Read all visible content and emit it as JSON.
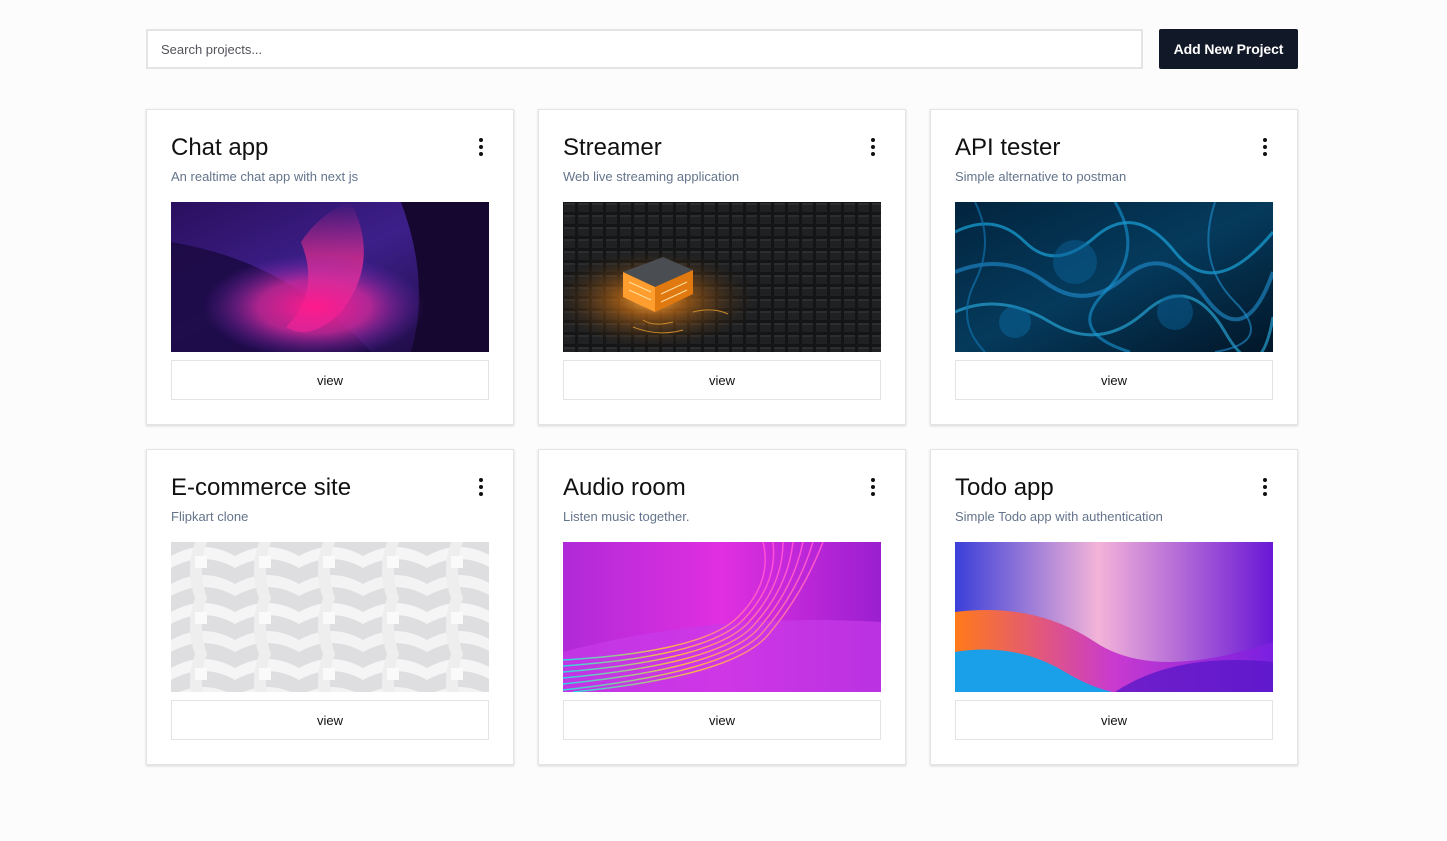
{
  "search": {
    "placeholder": "Search projects..."
  },
  "toolbar": {
    "add_label": "Add New Project"
  },
  "projects": [
    {
      "title": "Chat app",
      "description": "An realtime chat app with next js",
      "view_label": "view",
      "image": "purple-pink-gradient-image"
    },
    {
      "title": "Streamer",
      "description": "Web live streaming application",
      "view_label": "view",
      "image": "glowing-chip-image"
    },
    {
      "title": "API tester",
      "description": "Simple alternative to postman",
      "view_label": "view",
      "image": "blue-fluid-image"
    },
    {
      "title": "E-commerce site",
      "description": "Flipkart clone",
      "view_label": "view",
      "image": "white-weave-pattern-image"
    },
    {
      "title": "Audio room",
      "description": "Listen music together.",
      "view_label": "view",
      "image": "magenta-lines-image"
    },
    {
      "title": "Todo app",
      "description": "Simple Todo app with authentication",
      "view_label": "view",
      "image": "violet-orange-wave-image"
    }
  ],
  "colors": {
    "accent": "#111827",
    "background": "#fcfcfc",
    "description_text": "#64748b"
  }
}
